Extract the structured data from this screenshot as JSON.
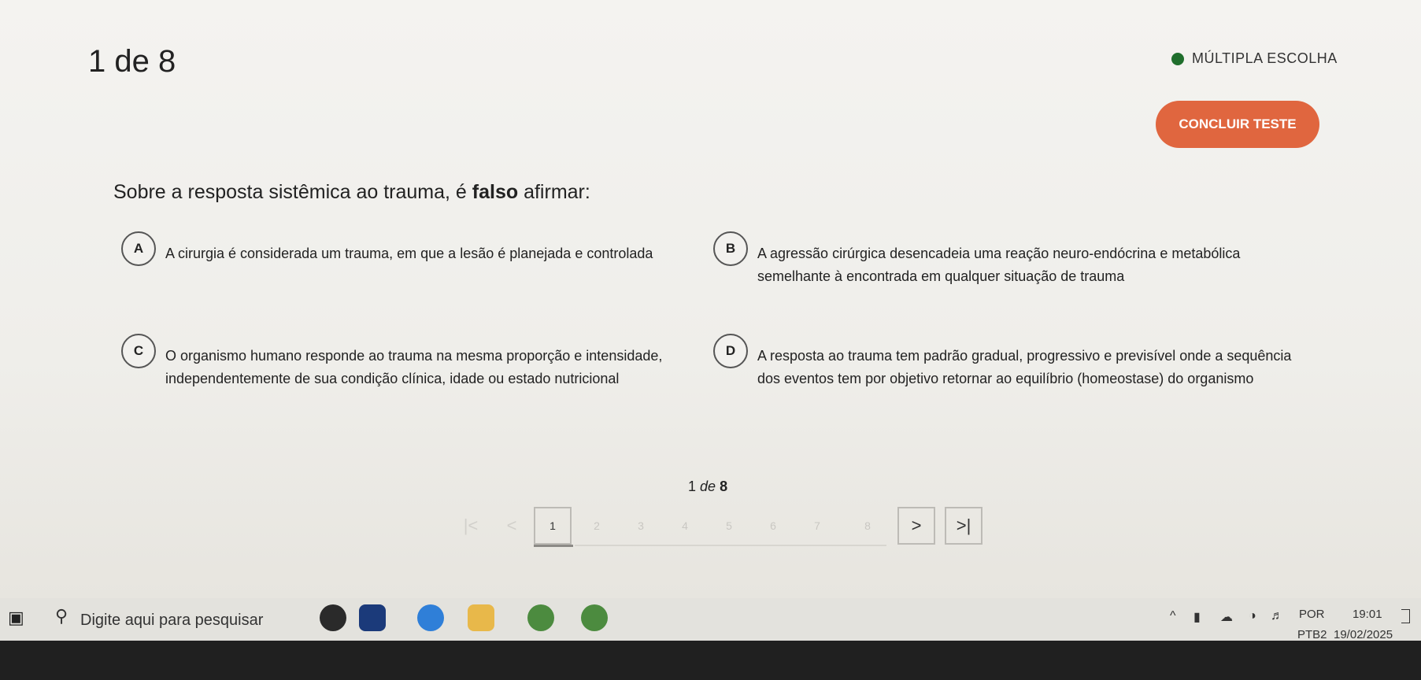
{
  "header": {
    "counter": "1 de 8",
    "question_type": "MÚLTIPLA ESCOLHA",
    "finish_button": "CONCLUIR TESTE"
  },
  "question": {
    "text_before": "Sobre a resposta sistêmica ao trauma, é ",
    "text_bold": "falso",
    "text_after": " afirmar:"
  },
  "options": [
    {
      "letter": "A",
      "text": "A cirurgia é considerada um trauma, em que a lesão é planejada e controlada"
    },
    {
      "letter": "B",
      "text": "A agressão cirúrgica desencadeia uma reação neuro-endócrina e metabólica semelhante à encontrada em qualquer situação de trauma"
    },
    {
      "letter": "C",
      "text": "O organismo humano responde ao trauma na mesma proporção e intensidade, independentemente de sua condição clínica, idade ou estado nutricional"
    },
    {
      "letter": "D",
      "text": "A resposta ao trauma tem padrão gradual, progressivo e previsível onde a sequência dos eventos tem por objetivo retornar ao equilíbrio (homeostase) do organismo"
    }
  ],
  "pagination": {
    "current": "1",
    "de": "de",
    "total": "8",
    "pages": [
      "1",
      "2",
      "3",
      "4",
      "5",
      "6",
      "7",
      "8"
    ],
    "first_symbol": "|<",
    "prev_symbol": "<",
    "next_symbol": ">",
    "last_symbol": ">|"
  },
  "taskbar": {
    "search_placeholder": "Digite aqui para pesquisar",
    "language_line1": "POR",
    "language_line2": "PTB2",
    "time": "19:01",
    "date": "19/02/2025"
  },
  "colors": {
    "accent": "#e0663f",
    "badge_dot": "#1f6e2c"
  }
}
